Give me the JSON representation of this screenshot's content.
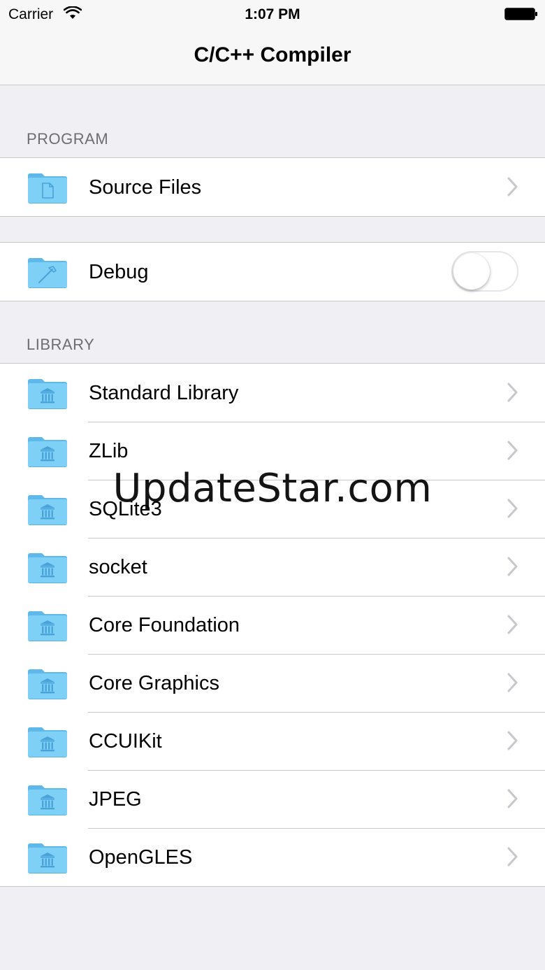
{
  "status_bar": {
    "carrier": "Carrier",
    "time": "1:07 PM",
    "wifi_icon": "wifi-icon",
    "battery_icon": "battery-full-icon"
  },
  "nav": {
    "title": "C/C++ Compiler"
  },
  "sections": {
    "program_header": "PROGRAM",
    "library_header": "LIBRARY"
  },
  "program": {
    "source_files": {
      "label": "Source Files",
      "icon": "source-folder-icon"
    }
  },
  "debug": {
    "label": "Debug",
    "icon": "hammer-folder-icon",
    "toggle_on": false
  },
  "library": {
    "items": [
      {
        "label": "Standard Library",
        "icon": "library-folder-icon"
      },
      {
        "label": "ZLib",
        "icon": "library-folder-icon"
      },
      {
        "label": "SQLite3",
        "icon": "library-folder-icon"
      },
      {
        "label": "socket",
        "icon": "library-folder-icon"
      },
      {
        "label": "Core Foundation",
        "icon": "library-folder-icon"
      },
      {
        "label": "Core Graphics",
        "icon": "library-folder-icon"
      },
      {
        "label": "CCUIKit",
        "icon": "library-folder-icon"
      },
      {
        "label": "JPEG",
        "icon": "library-folder-icon"
      },
      {
        "label": "OpenGLES",
        "icon": "library-folder-icon"
      }
    ]
  },
  "watermark": "UpdateStar.com",
  "colors": {
    "folder": "#7fd0f7",
    "background": "#efeff4",
    "separator": "#c8c7cc",
    "header_text": "#6d6d72",
    "chevron": "#c7c7cc"
  }
}
